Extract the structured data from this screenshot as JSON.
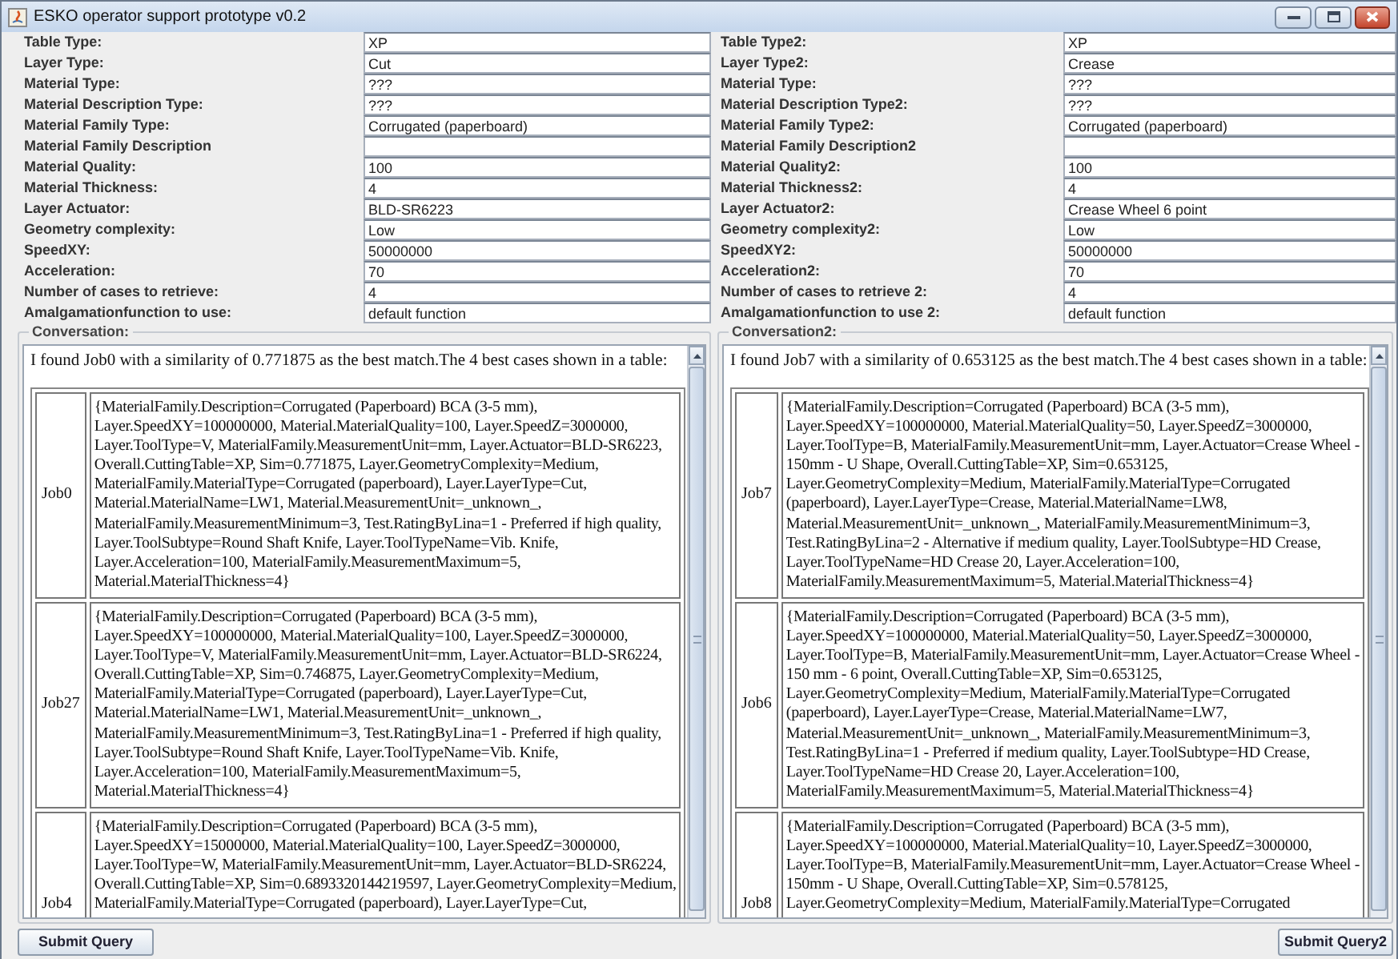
{
  "window": {
    "title": "ESKO operator support prototype v0.2"
  },
  "columns": [
    {
      "fields": [
        {
          "label": "Table Type:",
          "value": "XP"
        },
        {
          "label": "Layer Type:",
          "value": "Cut"
        },
        {
          "label": "Material Type:",
          "value": "???"
        },
        {
          "label": "Material Description Type:",
          "value": "???"
        },
        {
          "label": "Material Family Type:",
          "value": "Corrugated (paperboard)"
        },
        {
          "label": "Material Family Description"
        },
        {
          "label": "Material Quality:",
          "value": "100"
        },
        {
          "label": "Material Thickness:",
          "value": "4"
        },
        {
          "label": "Layer Actuator:",
          "value": "BLD-SR6223"
        },
        {
          "label": "Geometry complexity:",
          "value": "Low"
        },
        {
          "label": "SpeedXY:",
          "value": "50000000"
        },
        {
          "label": "Acceleration:",
          "value": "70"
        },
        {
          "label": "Number of cases to retrieve:",
          "value": "4"
        },
        {
          "label": "Amalgamationfunction to use:",
          "value": "default function"
        }
      ],
      "conversation": {
        "title": "Conversation:",
        "message": "I found Job0 with a similarity of 0.771875 as the best match.The 4 best cases shown in a table:",
        "cases": [
          {
            "job": "Job0",
            "lines": [
              "{MaterialFamily.Description=Corrugated (Paperboard) BCA (3-5 mm),",
              "Layer.SpeedXY=100000000, Material.MaterialQuality=100, Layer.SpeedZ=3000000,",
              "Layer.ToolType=V, MaterialFamily.MeasurementUnit=mm, Layer.Actuator=BLD-SR6223,",
              "Overall.CuttingTable=XP, Sim=0.771875, Layer.GeometryComplexity=Medium,",
              "MaterialFamily.MaterialType=Corrugated (paperboard), Layer.LayerType=Cut,",
              "Material.MaterialName=LW1, Material.MeasurementUnit=_unknown_,",
              "MaterialFamily.MeasurementMinimum=3, Test.RatingByLina=1 - Preferred if high quality,",
              "Layer.ToolSubtype=Round Shaft Knife, Layer.ToolTypeName=Vib. Knife,",
              "Layer.Acceleration=100, MaterialFamily.MeasurementMaximum=5,",
              "Material.MaterialThickness=4}"
            ]
          },
          {
            "job": "Job27",
            "lines": [
              "{MaterialFamily.Description=Corrugated (Paperboard) BCA (3-5 mm),",
              "Layer.SpeedXY=100000000, Material.MaterialQuality=100, Layer.SpeedZ=3000000,",
              "Layer.ToolType=V, MaterialFamily.MeasurementUnit=mm, Layer.Actuator=BLD-SR6224,",
              "Overall.CuttingTable=XP, Sim=0.746875, Layer.GeometryComplexity=Medium,",
              "MaterialFamily.MaterialType=Corrugated (paperboard), Layer.LayerType=Cut,",
              "Material.MaterialName=LW1, Material.MeasurementUnit=_unknown_,",
              "MaterialFamily.MeasurementMinimum=3, Test.RatingByLina=1 - Preferred if high quality,",
              "Layer.ToolSubtype=Round Shaft Knife, Layer.ToolTypeName=Vib. Knife,",
              "Layer.Acceleration=100, MaterialFamily.MeasurementMaximum=5,",
              "Material.MaterialThickness=4}"
            ]
          },
          {
            "job": "Job4",
            "lines": [
              "{MaterialFamily.Description=Corrugated (Paperboard) BCA (3-5 mm),",
              "Layer.SpeedXY=15000000, Material.MaterialQuality=100, Layer.SpeedZ=3000000,",
              "Layer.ToolType=W, MaterialFamily.MeasurementUnit=mm, Layer.Actuator=BLD-SR6224,",
              "Overall.CuttingTable=XP, Sim=0.6893320144219597, Layer.GeometryComplexity=Medium,",
              "MaterialFamily.MaterialType=Corrugated (paperboard), Layer.LayerType=Cut,"
            ]
          }
        ]
      },
      "button": "Submit Query"
    },
    {
      "fields": [
        {
          "label": "Table Type2:",
          "value": "XP"
        },
        {
          "label": "Layer Type2:",
          "value": "Crease"
        },
        {
          "label": "Material Type:",
          "value": "???"
        },
        {
          "label": "Material Description Type2:",
          "value": "???"
        },
        {
          "label": "Material Family Type2:",
          "value": "Corrugated (paperboard)"
        },
        {
          "label": "Material Family Description2"
        },
        {
          "label": "Material Quality2:",
          "value": "100"
        },
        {
          "label": "Material Thickness2:",
          "value": "4"
        },
        {
          "label": "Layer Actuator2:",
          "value": "Crease Wheel 6 point"
        },
        {
          "label": "Geometry complexity2:",
          "value": "Low"
        },
        {
          "label": "SpeedXY2:",
          "value": "50000000"
        },
        {
          "label": "Acceleration2:",
          "value": "70"
        },
        {
          "label": "Number of cases to retrieve 2:",
          "value": "4"
        },
        {
          "label": "Amalgamationfunction to use 2:",
          "value": "default function"
        }
      ],
      "conversation": {
        "title": "Conversation2:",
        "message": "I found Job7 with a similarity of 0.653125 as the best match.The 4 best cases shown in a table:",
        "cases": [
          {
            "job": "Job7",
            "lines": [
              "{MaterialFamily.Description=Corrugated (Paperboard) BCA (3-5 mm),",
              "Layer.SpeedXY=100000000, Material.MaterialQuality=50, Layer.SpeedZ=3000000,",
              "Layer.ToolType=B, MaterialFamily.MeasurementUnit=mm, Layer.Actuator=Crease Wheel -",
              "150mm - U Shape, Overall.CuttingTable=XP, Sim=0.653125,",
              "Layer.GeometryComplexity=Medium, MaterialFamily.MaterialType=Corrugated",
              "(paperboard), Layer.LayerType=Crease, Material.MaterialName=LW8,",
              "Material.MeasurementUnit=_unknown_, MaterialFamily.MeasurementMinimum=3,",
              "Test.RatingByLina=2 - Alternative if medium quality, Layer.ToolSubtype=HD Crease,",
              "Layer.ToolTypeName=HD Crease 20, Layer.Acceleration=100,",
              "MaterialFamily.MeasurementMaximum=5, Material.MaterialThickness=4}"
            ]
          },
          {
            "job": "Job6",
            "lines": [
              "{MaterialFamily.Description=Corrugated (Paperboard) BCA (3-5 mm),",
              "Layer.SpeedXY=100000000, Material.MaterialQuality=50, Layer.SpeedZ=3000000,",
              "Layer.ToolType=B, MaterialFamily.MeasurementUnit=mm, Layer.Actuator=Crease Wheel -",
              "150 mm - 6 point, Overall.CuttingTable=XP, Sim=0.653125,",
              "Layer.GeometryComplexity=Medium, MaterialFamily.MaterialType=Corrugated",
              "(paperboard), Layer.LayerType=Crease, Material.MaterialName=LW7,",
              "Material.MeasurementUnit=_unknown_, MaterialFamily.MeasurementMinimum=3,",
              "Test.RatingByLina=1 - Preferred if medium quality, Layer.ToolSubtype=HD Crease,",
              "Layer.ToolTypeName=HD Crease 20, Layer.Acceleration=100,",
              "MaterialFamily.MeasurementMaximum=5, Material.MaterialThickness=4}"
            ]
          },
          {
            "job": "Job8",
            "lines": [
              "{MaterialFamily.Description=Corrugated (Paperboard) BCA (3-5 mm),",
              "Layer.SpeedXY=100000000, Material.MaterialQuality=10, Layer.SpeedZ=3000000,",
              "Layer.ToolType=B, MaterialFamily.MeasurementUnit=mm, Layer.Actuator=Crease Wheel -",
              "150mm - U Shape, Overall.CuttingTable=XP, Sim=0.578125,",
              "Layer.GeometryComplexity=Medium, MaterialFamily.MaterialType=Corrugated"
            ]
          }
        ]
      },
      "button": "Submit Query2"
    }
  ]
}
